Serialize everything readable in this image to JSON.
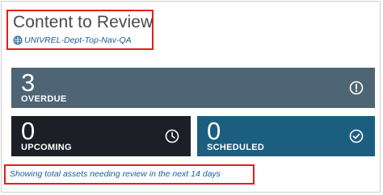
{
  "header": {
    "title": "Content to Review",
    "site_name": "UNIVREL-Dept-Top-Nav-QA",
    "site_icon": "globe-icon"
  },
  "tiles": {
    "overdue": {
      "count": "3",
      "label": "OVERDUE",
      "icon": "exclamation-circle-icon",
      "color": "#4d6575"
    },
    "upcoming": {
      "count": "0",
      "label": "UPCOMING",
      "icon": "clock-icon",
      "color": "#1d1f26"
    },
    "scheduled": {
      "count": "0",
      "label": "SCHEDULED",
      "icon": "check-circle-icon",
      "color": "#1b5e80"
    }
  },
  "footer": {
    "note": "Showing total assets needing review in the next 14 days"
  },
  "colors": {
    "highlight": "#e0201b",
    "link": "#1b5d96",
    "title": "#4a4a4a"
  }
}
